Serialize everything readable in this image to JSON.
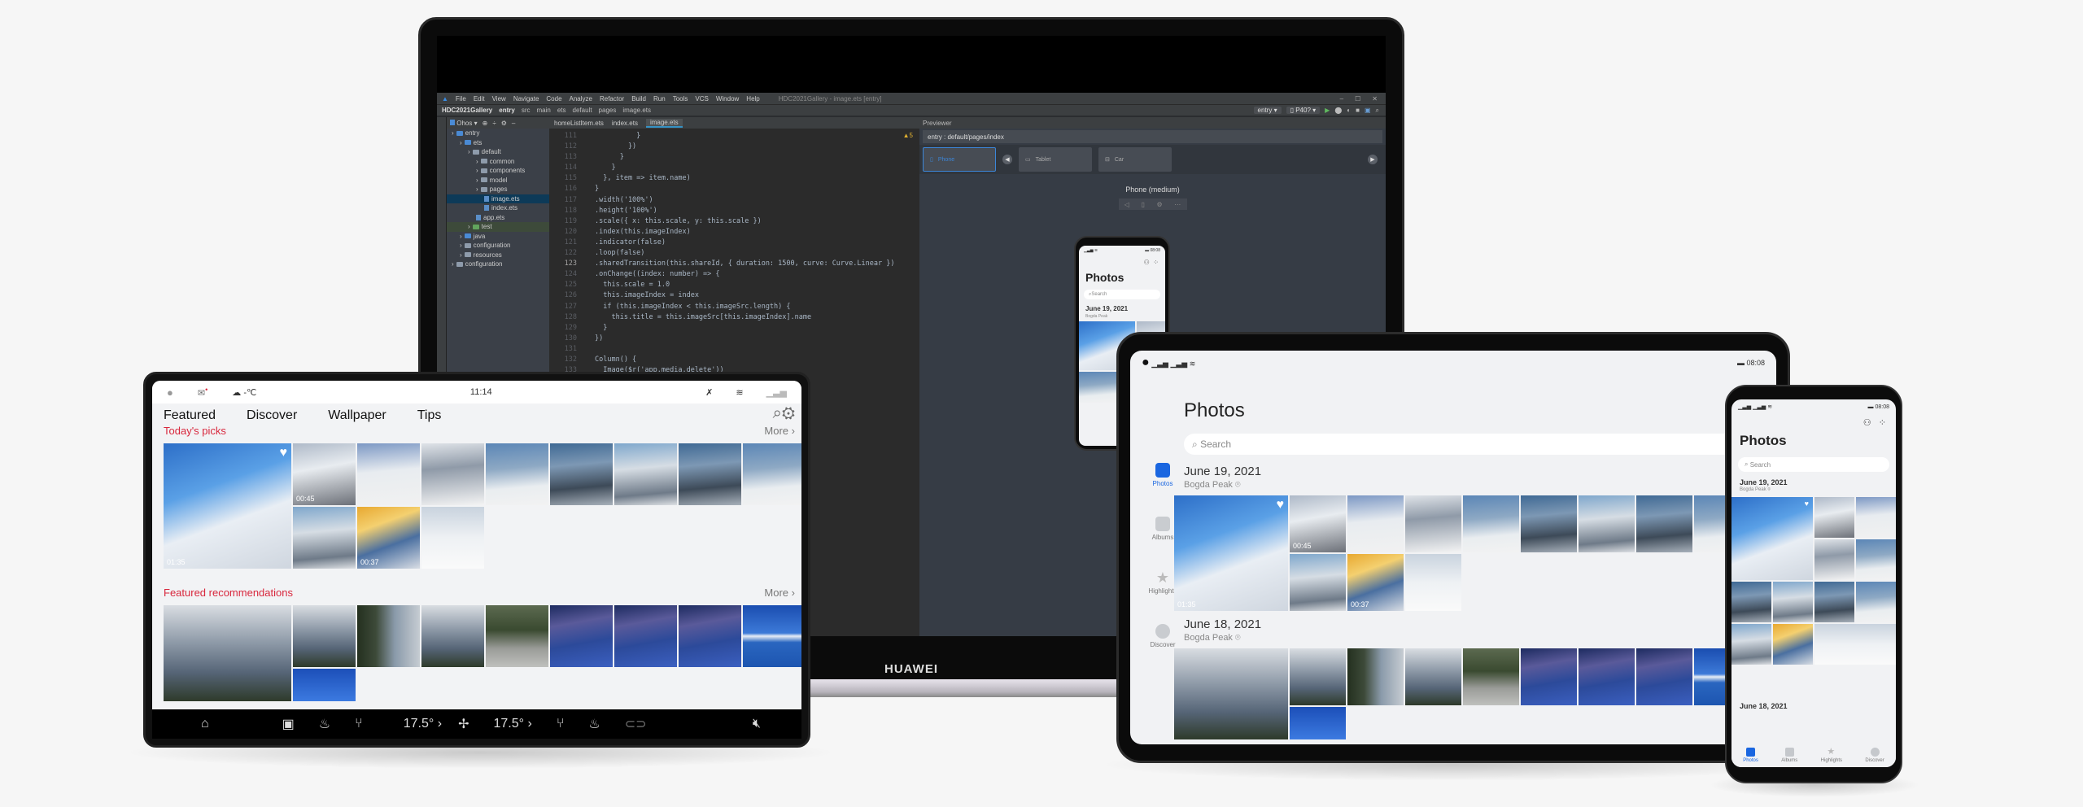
{
  "laptop": {
    "brand": "HUAWEI",
    "ide": {
      "menu": [
        "File",
        "Edit",
        "View",
        "Navigate",
        "Code",
        "Analyze",
        "Refactor",
        "Build",
        "Run",
        "Tools",
        "VCS",
        "Window",
        "Help"
      ],
      "window_title": "HDC2021Gallery - image.ets [entry]",
      "breadcrumb": [
        "HDC2021Gallery",
        "entry",
        "src",
        "main",
        "ets",
        "default",
        "pages",
        "image.ets"
      ],
      "run_config": "entry",
      "device": "P40?",
      "project_view": "Ohos",
      "tabs": [
        "homeListItem.ets",
        "index.ets",
        "image.ets"
      ],
      "active_tab": "image.ets",
      "tree": [
        {
          "label": "entry",
          "depth": 0,
          "type": "module"
        },
        {
          "label": "ets",
          "depth": 1,
          "type": "folder-blue"
        },
        {
          "label": "default",
          "depth": 2,
          "type": "folder"
        },
        {
          "label": "common",
          "depth": 3,
          "type": "folder"
        },
        {
          "label": "components",
          "depth": 3,
          "type": "folder"
        },
        {
          "label": "model",
          "depth": 3,
          "type": "folder"
        },
        {
          "label": "pages",
          "depth": 3,
          "type": "folder"
        },
        {
          "label": "image.ets",
          "depth": 4,
          "type": "file",
          "selected": true
        },
        {
          "label": "index.ets",
          "depth": 4,
          "type": "file"
        },
        {
          "label": "app.ets",
          "depth": 3,
          "type": "file"
        },
        {
          "label": "test",
          "depth": 2,
          "type": "folder-green"
        },
        {
          "label": "java",
          "depth": 1,
          "type": "folder-blue"
        },
        {
          "label": "configuration",
          "depth": 1,
          "type": "folder"
        },
        {
          "label": "resources",
          "depth": 1,
          "type": "folder"
        },
        {
          "label": "configuration",
          "depth": 0,
          "type": "folder"
        }
      ],
      "warnings": "5",
      "code_lines": [
        {
          "n": "111",
          "t": "          }"
        },
        {
          "n": "112",
          "t": "        })"
        },
        {
          "n": "113",
          "t": "      }"
        },
        {
          "n": "114",
          "t": "    }"
        },
        {
          "n": "115",
          "t": "  }, item => item.name)"
        },
        {
          "n": "116",
          "t": "}"
        },
        {
          "n": "117",
          "t": ".width('100%')"
        },
        {
          "n": "118",
          "t": ".height('100%')"
        },
        {
          "n": "119",
          "t": ".scale({ x: this.scale, y: this.scale })"
        },
        {
          "n": "120",
          "t": ".index(this.imageIndex)"
        },
        {
          "n": "121",
          "t": ".indicator(false)"
        },
        {
          "n": "122",
          "t": ".loop(false)"
        },
        {
          "n": "123",
          "t": ".sharedTransition(this.shareId, { duration: 1500, curve: Curve.Linear })"
        },
        {
          "n": "124",
          "t": ".onChange((index: number) => {"
        },
        {
          "n": "125",
          "t": "  this.scale = 1.0"
        },
        {
          "n": "126",
          "t": "  this.imageIndex = index"
        },
        {
          "n": "127",
          "t": "  if (this.imageIndex < this.imageSrc.length) {"
        },
        {
          "n": "128",
          "t": "    this.title = this.imageSrc[this.imageIndex].name"
        },
        {
          "n": "129",
          "t": "  }"
        },
        {
          "n": "130",
          "t": "})"
        },
        {
          "n": "131",
          "t": ""
        },
        {
          "n": "132",
          "t": "Column() {"
        },
        {
          "n": "133",
          "t": "  Image($r('app.media.delete'))"
        }
      ],
      "current_line": "123",
      "previewer": {
        "title": "Previewer",
        "path": "entry : default/pages/index",
        "devices": [
          "Phone",
          "Tablet",
          "Car"
        ],
        "selected_device": "Phone",
        "device_label": "Phone (medium)"
      }
    }
  },
  "gallery": {
    "title": "Photos",
    "search_placeholder": "Search",
    "groups": [
      {
        "date": "June 19, 2021",
        "location": "Bogda Peak"
      },
      {
        "date": "June 18, 2021",
        "location": "Bogda Peak"
      }
    ],
    "durations": [
      "01:35",
      "00:45",
      "00:37"
    ],
    "nav": [
      "Photos",
      "Albums",
      "Highlights",
      "Discover"
    ],
    "active_nav": "Photos",
    "status_time": "08:08"
  },
  "car": {
    "status_time": "11:14",
    "weather": "-℃",
    "tabs": [
      "Featured",
      "Discover",
      "Wallpaper",
      "Tips"
    ],
    "sections": [
      {
        "title": "Today's picks",
        "more": "More"
      },
      {
        "title": "Featured recommendations",
        "more": "More"
      }
    ],
    "dock": {
      "temp_left": "17.5°",
      "temp_right": "17.5°"
    }
  },
  "colors": {
    "accent_red": "#d8263c",
    "accent_blue": "#1a66e0",
    "ide_bg": "#2b2b2b"
  }
}
